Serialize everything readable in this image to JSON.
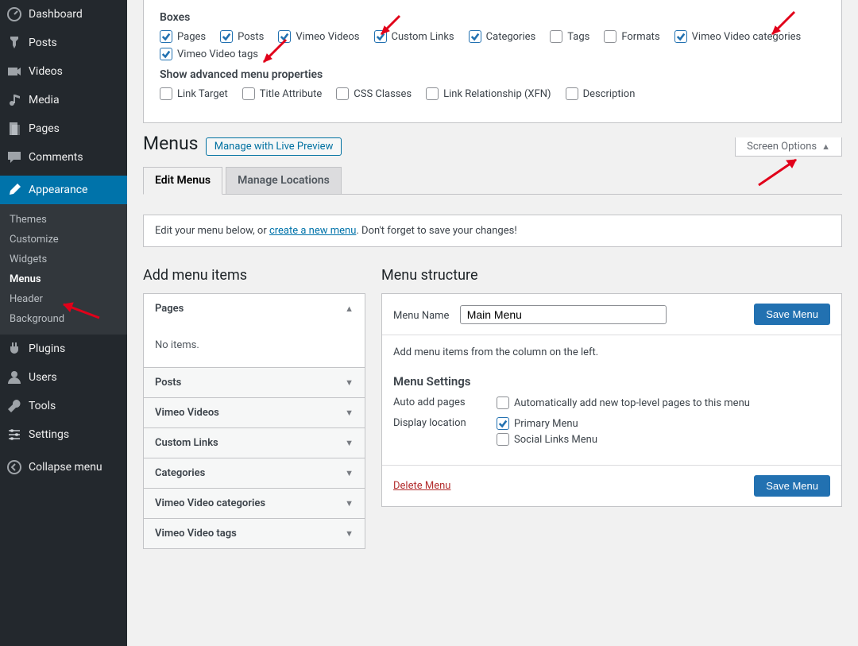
{
  "sidebar": {
    "items": [
      {
        "label": "Dashboard",
        "icon": "dashboard"
      },
      {
        "label": "Posts",
        "icon": "pin"
      },
      {
        "label": "Videos",
        "icon": "video"
      },
      {
        "label": "Media",
        "icon": "media"
      },
      {
        "label": "Pages",
        "icon": "page"
      },
      {
        "label": "Comments",
        "icon": "comment"
      },
      {
        "label": "Appearance",
        "icon": "brush",
        "current": true
      },
      {
        "label": "Plugins",
        "icon": "plugin"
      },
      {
        "label": "Users",
        "icon": "user"
      },
      {
        "label": "Tools",
        "icon": "tool"
      },
      {
        "label": "Settings",
        "icon": "settings"
      },
      {
        "label": "Collapse menu",
        "icon": "collapse"
      }
    ],
    "submenu": [
      "Themes",
      "Customize",
      "Widgets",
      "Menus",
      "Header",
      "Background"
    ],
    "submenu_active_index": 3
  },
  "screen_options": {
    "toggle_label": "Screen Options",
    "boxes_heading": "Boxes",
    "boxes": [
      {
        "label": "Pages",
        "checked": true
      },
      {
        "label": "Posts",
        "checked": true
      },
      {
        "label": "Vimeo Videos",
        "checked": true
      },
      {
        "label": "Custom Links",
        "checked": true
      },
      {
        "label": "Categories",
        "checked": true
      },
      {
        "label": "Tags",
        "checked": false
      },
      {
        "label": "Formats",
        "checked": false
      },
      {
        "label": "Vimeo Video categories",
        "checked": true
      },
      {
        "label": "Vimeo Video tags",
        "checked": true
      }
    ],
    "adv_heading": "Show advanced menu properties",
    "adv": [
      {
        "label": "Link Target",
        "checked": false
      },
      {
        "label": "Title Attribute",
        "checked": false
      },
      {
        "label": "CSS Classes",
        "checked": false
      },
      {
        "label": "Link Relationship (XFN)",
        "checked": false
      },
      {
        "label": "Description",
        "checked": false
      }
    ]
  },
  "page": {
    "title": "Menus",
    "live_preview_btn": "Manage with Live Preview",
    "tabs": [
      {
        "label": "Edit Menus",
        "active": true
      },
      {
        "label": "Manage Locations",
        "active": false
      }
    ],
    "notice_pre": "Edit your menu below, or ",
    "notice_link": "create a new menu",
    "notice_post": ". Don't forget to save your changes!"
  },
  "left_col": {
    "heading": "Add menu items",
    "pages_label": "Pages",
    "pages_body": "No items.",
    "sections": [
      "Posts",
      "Vimeo Videos",
      "Custom Links",
      "Categories",
      "Vimeo Video categories",
      "Vimeo Video tags"
    ]
  },
  "right_col": {
    "heading": "Menu structure",
    "menu_name_label": "Menu Name",
    "menu_name_value": "Main Menu",
    "save_btn": "Save Menu",
    "body_text": "Add menu items from the column on the left.",
    "settings_heading": "Menu Settings",
    "auto_add_label": "Auto add pages",
    "auto_add_cbx": "Automatically add new top-level pages to this menu",
    "display_loc_label": "Display location",
    "locations": [
      {
        "label": "Primary Menu",
        "checked": true
      },
      {
        "label": "Social Links Menu",
        "checked": false
      }
    ],
    "delete_label": "Delete Menu"
  }
}
